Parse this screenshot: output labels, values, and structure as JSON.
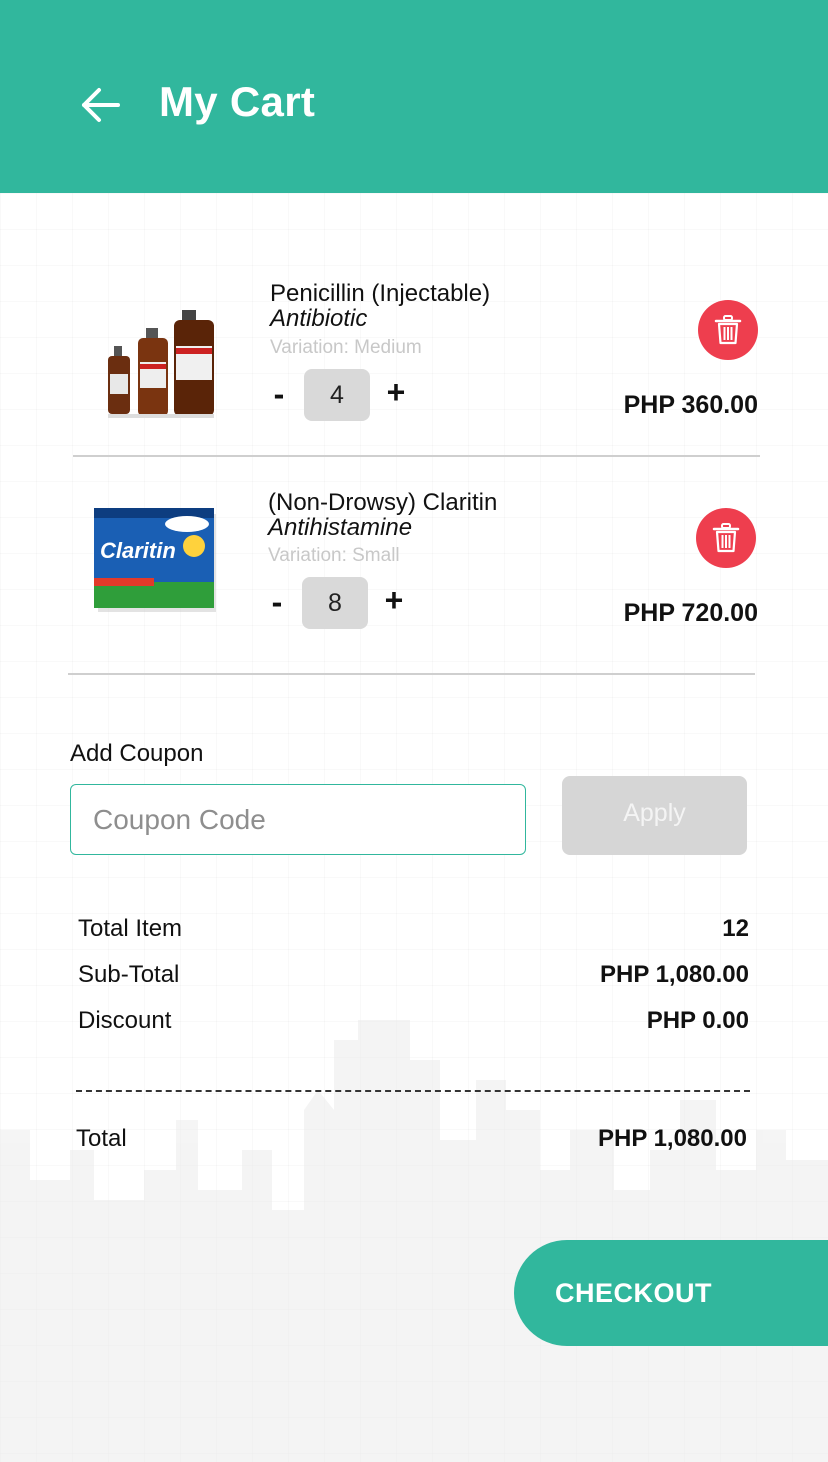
{
  "header": {
    "title": "My Cart",
    "background_color": "#31b79d",
    "back_icon": "arrow-left-icon"
  },
  "cart": {
    "items": [
      {
        "name": "Penicillin (Injectable)",
        "category": "Antibiotic",
        "variation": "Variation:  Medium",
        "quantity": "4",
        "minus_label": "-",
        "plus_label": "+",
        "price": "PHP 360.00",
        "product_image": "penicillin-bottles",
        "delete_icon": "trash-icon"
      },
      {
        "name": "(Non-Drowsy) Claritin",
        "category": "Antihistamine",
        "variation": "Variation:  Small",
        "quantity": "8",
        "minus_label": "-",
        "plus_label": "+",
        "price": "PHP 720.00",
        "product_image": "claritin-box",
        "delete_icon": "trash-icon"
      }
    ]
  },
  "coupon": {
    "label": "Add Coupon",
    "placeholder": "Coupon Code",
    "value": "",
    "apply_label": "Apply"
  },
  "summary": {
    "total_item_label": "Total Item",
    "total_item_value": "12",
    "subtotal_label": "Sub-Total",
    "subtotal_value": "PHP 1,080.00",
    "discount_label": "Discount",
    "discount_value": "PHP 0.00",
    "total_label": "Total",
    "total_value": "PHP 1,080.00"
  },
  "checkout": {
    "label": "CHECKOUT"
  },
  "colors": {
    "accent": "#31b79d",
    "delete": "#ee3e4e",
    "disabled_button": "#d6d6d6"
  }
}
